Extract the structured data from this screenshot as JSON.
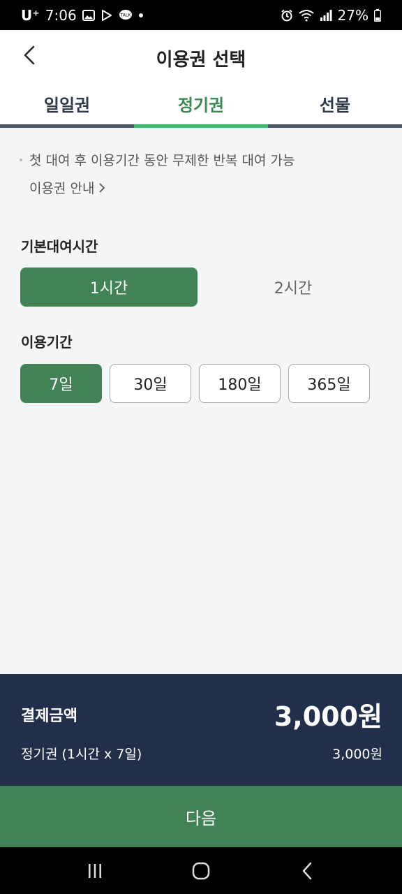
{
  "status_bar": {
    "carrier": "U⁺",
    "time": "7:06",
    "battery": "27%",
    "icons": [
      "image-icon",
      "play-store-icon",
      "talk-icon",
      "dot-icon",
      "alarm-icon",
      "wifi-icon",
      "signal-icon",
      "battery-icon"
    ]
  },
  "header": {
    "title": "이용권 선택",
    "back_icon": "chevron-left-icon"
  },
  "tabs": [
    {
      "label": "일일권",
      "active": false
    },
    {
      "label": "정기권",
      "active": true
    },
    {
      "label": "선물",
      "active": false
    }
  ],
  "info": {
    "description": "첫 대여 후 이용기간 동안 무제한 반복 대여 가능",
    "guide_link": "이용권 안내"
  },
  "basic_time": {
    "label": "기본대여시간",
    "options": [
      "1시간",
      "2시간"
    ],
    "selected": "1시간"
  },
  "period": {
    "label": "이용기간",
    "options": [
      "7일",
      "30일",
      "180일",
      "365일"
    ],
    "selected": "7일"
  },
  "payment": {
    "label": "결제금액",
    "total": "3,000원",
    "description": "정기권 (1시간 x 7일)",
    "description_amount": "3,000원"
  },
  "next_button": "다음",
  "colors": {
    "accent_green": "#428356",
    "tab_active": "#3dbb6a",
    "panel_navy": "#222f4a"
  }
}
